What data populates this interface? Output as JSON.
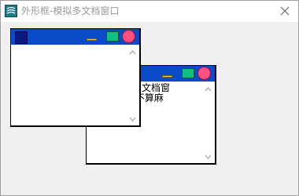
{
  "window": {
    "title": "外形框-模拟多文档窗口"
  },
  "back_child": {
    "text_lines": [
      "没有多文档窗",
      "是吗,不算麻"
    ]
  },
  "front_child": {
    "text_lines": []
  },
  "colors": {
    "titlebar_blue": "#0a4bc9",
    "icon_navy": "#0a1a80",
    "minimize_yellow": "#f0d800",
    "maximize_green": "#10c080",
    "close_pink": "#ff5080"
  },
  "icons": {
    "app": "app-logo-icon",
    "close": "close-x-icon",
    "child_min": "minimize-icon",
    "child_max": "maximize-icon",
    "child_close": "close-circle-icon"
  }
}
